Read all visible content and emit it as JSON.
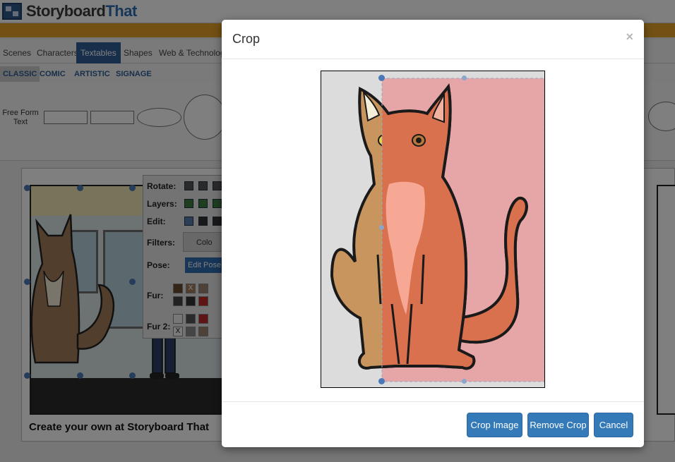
{
  "app": {
    "brand_prefix": "Storyboard",
    "brand_suffix": "That"
  },
  "tabs": [
    {
      "label": "Scenes",
      "active": false
    },
    {
      "label": "Characters",
      "active": false
    },
    {
      "label": "Textables",
      "active": true
    },
    {
      "label": "Shapes",
      "active": false
    },
    {
      "label": "Web & Technology",
      "active": false
    }
  ],
  "subtabs": [
    {
      "label": "CLASSIC",
      "active": true
    },
    {
      "label": "COMIC",
      "active": false
    },
    {
      "label": "ARTISTIC",
      "active": false
    },
    {
      "label": "SIGNAGE",
      "active": false
    }
  ],
  "shapes_row": {
    "free_form_label": "Free Form Text"
  },
  "toolbox": {
    "rotate_label": "Rotate:",
    "layers_label": "Layers:",
    "edit_label": "Edit:",
    "filters_label": "Filters:",
    "filters_value": "Colo",
    "pose_label": "Pose:",
    "edit_pose_button": "Edit Pose",
    "fur_label": "Fur:",
    "fur2_label": "Fur 2:",
    "clear_mark": "X"
  },
  "canvas": {
    "caption": "Create your own at Storyboard That"
  },
  "modal": {
    "title": "Crop",
    "close_symbol": "×",
    "buttons": {
      "crop_image": "Crop Image",
      "remove_crop": "Remove Crop",
      "cancel": "Cancel"
    }
  },
  "colors": {
    "primary_button": "#347ab8",
    "brand_blue": "#2e6db0",
    "orange_bar": "#e7a228",
    "crop_overlay": "#e6a6a8",
    "cat_fur": "#c8955f",
    "cat_fur_cropped": "#d9714f"
  }
}
